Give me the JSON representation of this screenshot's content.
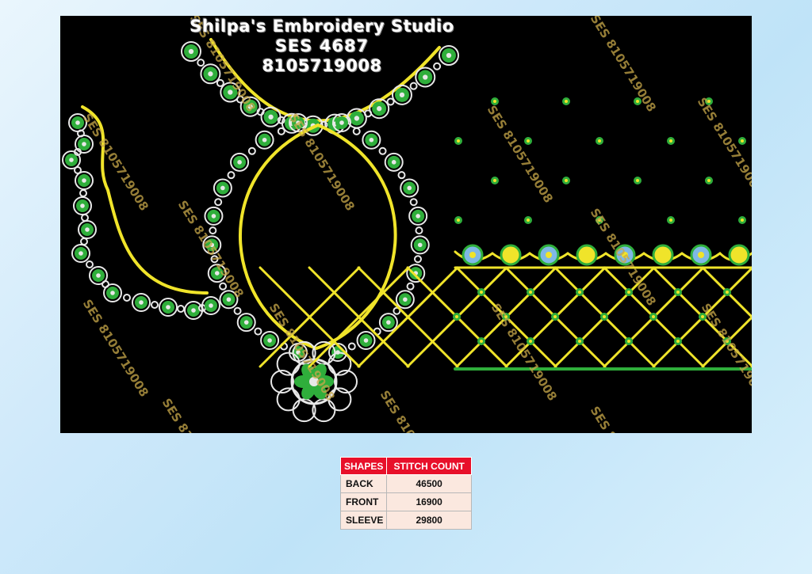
{
  "studio": {
    "name": "Shilpa's Embroidery Studio",
    "code": "SES  4687",
    "phone": "8105719008"
  },
  "watermark": "SES 8105719008",
  "colors": {
    "background": "#000000",
    "thread_yellow": "#f0e42a",
    "thread_green": "#2fae3b",
    "thread_white": "#e8e8e8",
    "thread_blue": "#7fb8e6",
    "header_red": "#e8102a"
  },
  "stitch_table": {
    "headers": [
      "SHAPES",
      "STITCH COUNT"
    ],
    "rows": [
      {
        "shape": "BACK",
        "count": "46500"
      },
      {
        "shape": "FRONT",
        "count": "16900"
      },
      {
        "shape": "SLEEVE",
        "count": "29800"
      }
    ]
  }
}
